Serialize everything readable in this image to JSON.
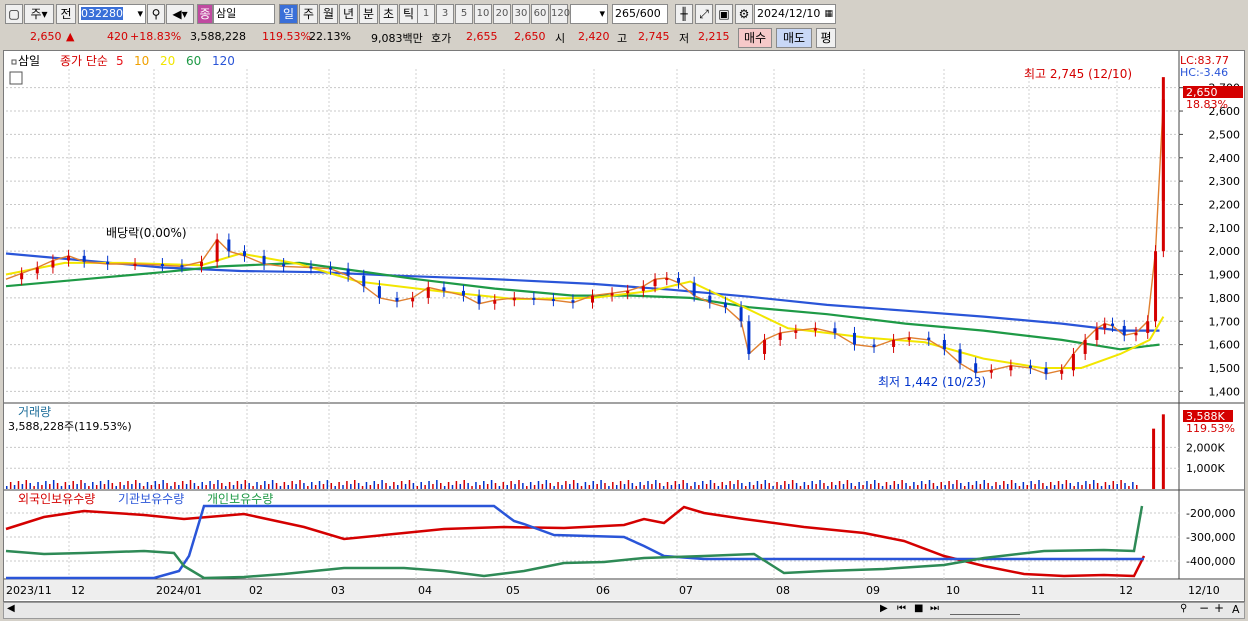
{
  "toolbar": {
    "type_label": "주",
    "prev_label": "전",
    "code_value": "032280",
    "name_badge": "종",
    "stock_name": "삼일",
    "periods": [
      "일",
      "주",
      "월",
      "년",
      "분",
      "초",
      "틱"
    ],
    "active_period": "일",
    "minutes": [
      "1",
      "3",
      "5",
      "10",
      "20",
      "30",
      "60",
      "120"
    ],
    "count_value": "265",
    "count_total": "/600",
    "date_value": "2024/12/10"
  },
  "info": {
    "price": "2,650",
    "change": "420",
    "change_pct": "+18.83%",
    "volume": "3,588,228",
    "volume_ratio": "119.53%",
    "turnover": "22.13%",
    "amount": "9,083백만",
    "ask_label": "호가",
    "ask": "2,655",
    "bid": "2,650",
    "open_label": "시",
    "open": "2,420",
    "high_label": "고",
    "high": "2,745",
    "low_label": "저",
    "low": "2,215",
    "buy_button": "매수",
    "sell_button": "매도",
    "avg_button": "평"
  },
  "price_panel": {
    "stock_label": "삼일",
    "ma_label": "종가 단순",
    "ma_periods": [
      "5",
      "10",
      "20",
      "60",
      "120"
    ],
    "ma_colors": [
      "#e8141a",
      "#f0a000",
      "#f2e600",
      "#1e9a46",
      "#2a55d8"
    ],
    "lc": "LC:83.77",
    "hc": "HC:-3.46",
    "last_price_tag": "2,650",
    "last_pct_tag": "18.83%",
    "dividend_note": "배당락(0.00%)",
    "high_note": "최고 2,745 (12/10)",
    "low_note": "최저 1,442 (10/23)"
  },
  "volume_panel": {
    "title": "거래량",
    "detail": "3,588,228주(119.53%)",
    "tag": "3,588K",
    "tag_pct": "119.53%",
    "ticks": [
      "2,000K",
      "1,000K"
    ]
  },
  "holder_panel": {
    "foreign_label": "외국인보유수량",
    "inst_label": "기관보유수량",
    "indiv_label": "개인보유수량",
    "ticks": [
      "-200,000",
      "-300,000",
      "-400,000"
    ]
  },
  "x_axis": [
    "2023/11",
    "12",
    "2024/01",
    "02",
    "03",
    "04",
    "05",
    "06",
    "07",
    "08",
    "09",
    "10",
    "11",
    "12",
    "12/10"
  ],
  "chart_data": {
    "type": "line",
    "ylim": [
      1350,
      2780
    ],
    "yticks": [
      1400,
      1500,
      1600,
      1700,
      1800,
      1900,
      2000,
      2100,
      2200,
      2300,
      2400,
      2500,
      2600,
      2700
    ],
    "close": [
      [
        0,
        1880
      ],
      [
        8,
        1905
      ],
      [
        16,
        1930
      ],
      [
        24,
        1960
      ],
      [
        32,
        1980
      ],
      [
        40,
        1955
      ],
      [
        52,
        1945
      ],
      [
        66,
        1945
      ],
      [
        80,
        1940
      ],
      [
        90,
        1935
      ],
      [
        100,
        1955
      ],
      [
        108,
        2050
      ],
      [
        114,
        2000
      ],
      [
        122,
        1980
      ],
      [
        132,
        1945
      ],
      [
        142,
        1935
      ],
      [
        156,
        1930
      ],
      [
        166,
        1925
      ],
      [
        175,
        1895
      ],
      [
        183,
        1850
      ],
      [
        191,
        1800
      ],
      [
        200,
        1785
      ],
      [
        208,
        1800
      ],
      [
        216,
        1845
      ],
      [
        224,
        1830
      ],
      [
        234,
        1810
      ],
      [
        242,
        1775
      ],
      [
        250,
        1790
      ],
      [
        260,
        1800
      ],
      [
        270,
        1795
      ],
      [
        280,
        1790
      ],
      [
        290,
        1780
      ],
      [
        300,
        1810
      ],
      [
        310,
        1820
      ],
      [
        318,
        1830
      ],
      [
        326,
        1850
      ],
      [
        332,
        1880
      ],
      [
        338,
        1885
      ],
      [
        344,
        1865
      ],
      [
        352,
        1810
      ],
      [
        360,
        1780
      ],
      [
        368,
        1760
      ],
      [
        376,
        1700
      ],
      [
        380,
        1560
      ],
      [
        388,
        1620
      ],
      [
        396,
        1650
      ],
      [
        404,
        1660
      ],
      [
        414,
        1670
      ],
      [
        424,
        1650
      ],
      [
        434,
        1600
      ],
      [
        444,
        1590
      ],
      [
        454,
        1620
      ],
      [
        462,
        1630
      ],
      [
        472,
        1620
      ],
      [
        480,
        1580
      ],
      [
        488,
        1520
      ],
      [
        496,
        1480
      ],
      [
        504,
        1490
      ],
      [
        514,
        1510
      ],
      [
        524,
        1500
      ],
      [
        532,
        1475
      ],
      [
        540,
        1490
      ],
      [
        546,
        1560
      ],
      [
        552,
        1620
      ],
      [
        558,
        1670
      ],
      [
        562,
        1690
      ],
      [
        566,
        1680
      ],
      [
        572,
        1640
      ],
      [
        578,
        1650
      ],
      [
        584,
        1700
      ],
      [
        588,
        2000
      ],
      [
        592,
        2650
      ]
    ],
    "ma120": [
      [
        0,
        1990
      ],
      [
        40,
        1960
      ],
      [
        80,
        1930
      ],
      [
        120,
        1915
      ],
      [
        160,
        1910
      ],
      [
        200,
        1895
      ],
      [
        250,
        1880
      ],
      [
        300,
        1860
      ],
      [
        340,
        1835
      ],
      [
        380,
        1805
      ],
      [
        420,
        1770
      ],
      [
        460,
        1745
      ],
      [
        500,
        1720
      ],
      [
        540,
        1690
      ],
      [
        570,
        1660
      ],
      [
        590,
        1660
      ]
    ],
    "ma60": [
      [
        0,
        1850
      ],
      [
        40,
        1880
      ],
      [
        80,
        1910
      ],
      [
        110,
        1935
      ],
      [
        150,
        1950
      ],
      [
        180,
        1915
      ],
      [
        210,
        1880
      ],
      [
        250,
        1840
      ],
      [
        290,
        1810
      ],
      [
        320,
        1810
      ],
      [
        350,
        1800
      ],
      [
        380,
        1760
      ],
      [
        420,
        1730
      ],
      [
        460,
        1690
      ],
      [
        500,
        1660
      ],
      [
        540,
        1620
      ],
      [
        570,
        1580
      ],
      [
        590,
        1600
      ]
    ],
    "ma20": [
      [
        0,
        1900
      ],
      [
        30,
        1950
      ],
      [
        60,
        1950
      ],
      [
        100,
        1940
      ],
      [
        120,
        1990
      ],
      [
        150,
        1945
      ],
      [
        180,
        1870
      ],
      [
        220,
        1830
      ],
      [
        260,
        1795
      ],
      [
        300,
        1800
      ],
      [
        330,
        1830
      ],
      [
        350,
        1870
      ],
      [
        370,
        1790
      ],
      [
        400,
        1670
      ],
      [
        440,
        1630
      ],
      [
        470,
        1610
      ],
      [
        500,
        1540
      ],
      [
        530,
        1500
      ],
      [
        550,
        1500
      ],
      [
        570,
        1560
      ],
      [
        585,
        1620
      ],
      [
        592,
        1720
      ]
    ],
    "volume_peak": 3588228,
    "volume_ylim": [
      0,
      3700000
    ],
    "volume_spikes": [
      [
        587,
        2900000
      ],
      [
        592,
        3588228
      ]
    ]
  }
}
